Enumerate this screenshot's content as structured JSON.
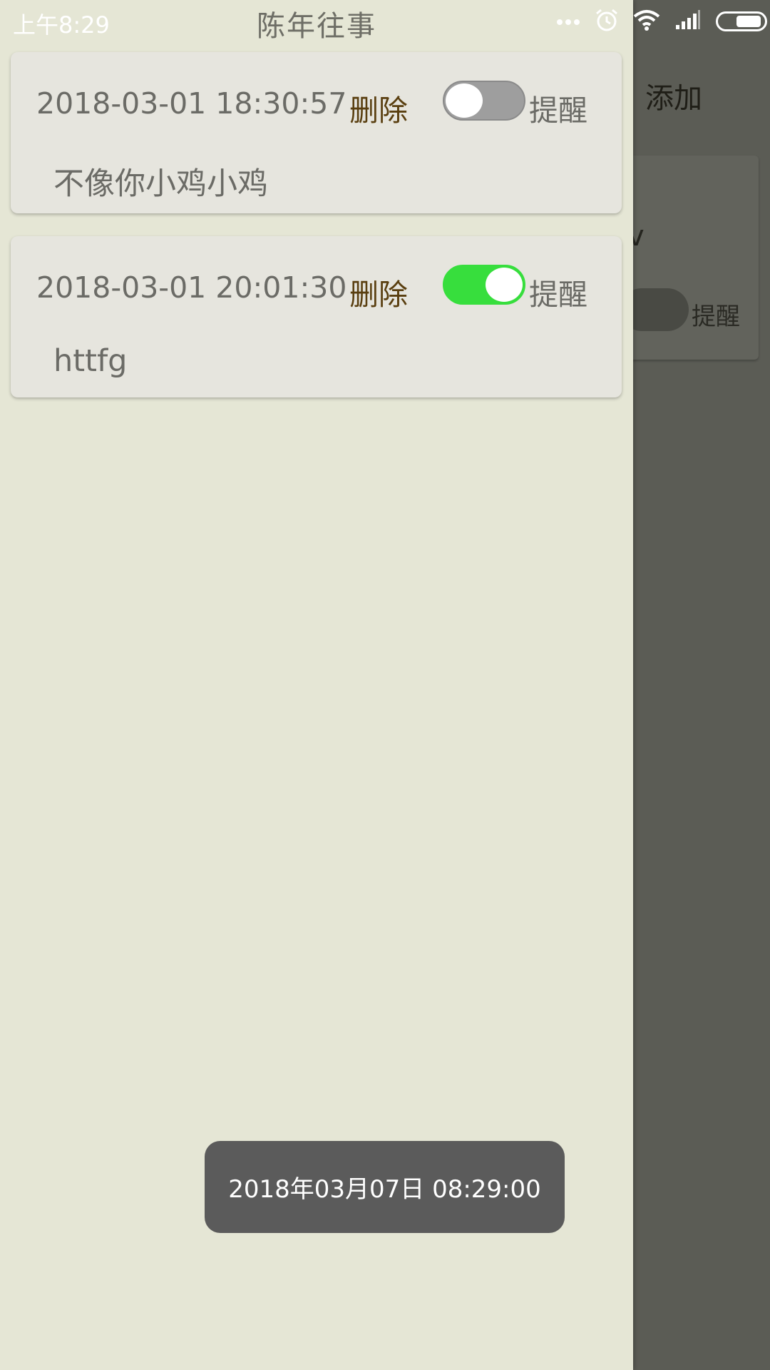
{
  "status_bar": {
    "time": "上午8:29",
    "icons": [
      "more-dots-icon",
      "alarm-icon",
      "wifi-icon",
      "signal-icon",
      "battery-icon"
    ]
  },
  "background_page": {
    "add_label": "添加",
    "card_partial_text": "v",
    "card_remind_label": "提醒"
  },
  "drawer": {
    "title": "陈年往事",
    "cards": [
      {
        "datetime": "2018-03-01 18:30:57",
        "delete_label": "删除",
        "remind_label": "提醒",
        "remind_on": false,
        "content": "不像你小鸡小鸡"
      },
      {
        "datetime": "2018-03-01 20:01:30",
        "delete_label": "删除",
        "remind_label": "提醒",
        "remind_on": true,
        "content": "httfg"
      }
    ]
  },
  "toast": {
    "text": "2018年03月07日 08:29:00"
  },
  "colors": {
    "drawer_bg": "#e5e6d5",
    "card_bg": "#e6e5de",
    "delete_text": "#5a3f10",
    "toggle_on": "#37de3d",
    "toggle_off": "#9e9e9e",
    "dim_overlay": "#5b5c55"
  }
}
